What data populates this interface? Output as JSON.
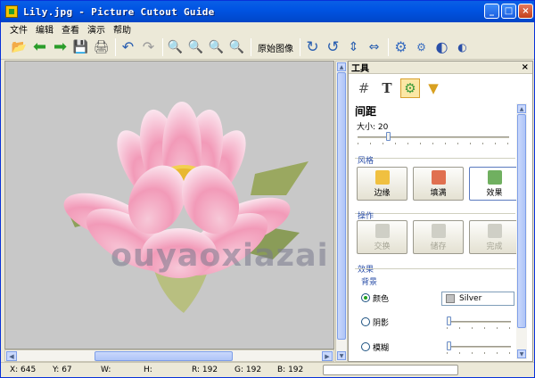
{
  "window": {
    "title": "Lily.jpg - Picture Cutout Guide"
  },
  "menu": [
    "文件",
    "编辑",
    "查看",
    "演示",
    "帮助"
  ],
  "toolbar": {
    "original_image_label": "原始图像"
  },
  "panel": {
    "header": "工具",
    "close": "×",
    "section_title": "间距",
    "size_label": "大小: 20",
    "size_value": 20,
    "style_group": "风格",
    "style_buttons": [
      "边缘",
      "填满",
      "效果"
    ],
    "ops_group": "操作",
    "ops_buttons": [
      "交换",
      "储存",
      "完成"
    ],
    "effect_group": "效果",
    "background_label": "背景",
    "radios": [
      "颜色",
      "阴影",
      "模糊"
    ],
    "color_value": "Silver"
  },
  "status": {
    "x": "X: 645",
    "y": "Y: 67",
    "w": "W:",
    "h": "H:",
    "r": "R: 192",
    "g": "G: 192",
    "b": "B: 192"
  },
  "watermark": "ouyaoxiazai",
  "colors": {
    "canvas_bg": "#c8c8c8",
    "titlebar": "#0054e3",
    "accent": "#2b4fa8"
  }
}
